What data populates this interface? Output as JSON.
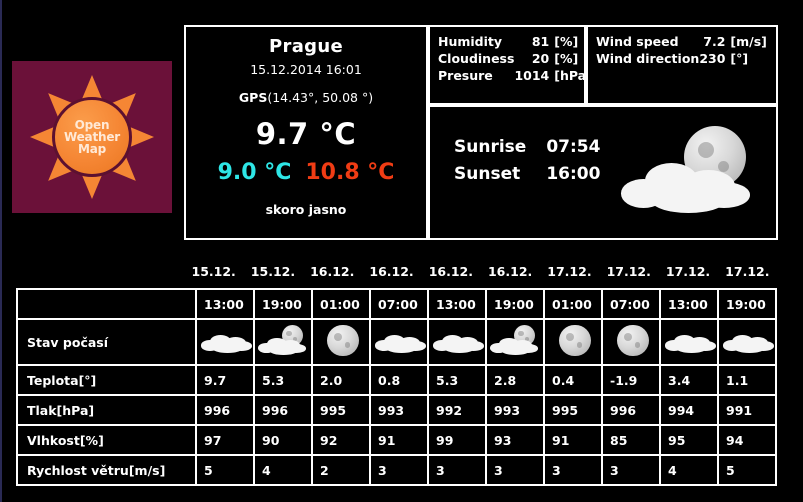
{
  "logo": {
    "name": "OpenWeatherMap",
    "line1": "Open",
    "line2": "Weather",
    "line3": "Map",
    "background_color": "#6b1139",
    "sun_color": "#f58634"
  },
  "current": {
    "city": "Prague",
    "datetime": "15.12.2014 16:01",
    "gps_label": "GPS",
    "gps_value": "(14.43°,  50.08 °)",
    "temperature": "9.7 °C",
    "temp_min": "9.0 °C",
    "temp_max": "10.8 °C",
    "temp_min_color": "#2ee6e6",
    "temp_max_color": "#f03c14",
    "description": "skoro jasno"
  },
  "metrics_left": [
    {
      "name": "Humidity",
      "value": "81",
      "unit": "[%]"
    },
    {
      "name": "Cloudiness",
      "value": "20",
      "unit": "[%]"
    },
    {
      "name": "Presure",
      "value": "1014",
      "unit": "[hPa]"
    }
  ],
  "metrics_right": [
    {
      "name": "Wind speed",
      "value": "7.2",
      "unit": "[m/s]"
    },
    {
      "name": "Wind direction",
      "value": "230",
      "unit": "[°]"
    }
  ],
  "sun": {
    "sunrise_label": "Sunrise",
    "sunrise_value": "07:54",
    "sunset_label": "Sunset",
    "sunset_value": "16:00",
    "icon": "moon-behind-cloud-icon"
  },
  "forecast": {
    "dates": [
      "15.12.",
      "15.12.",
      "16.12.",
      "16.12.",
      "16.12.",
      "16.12.",
      "17.12.",
      "17.12.",
      "17.12.",
      "17.12."
    ],
    "times": [
      "13:00",
      "19:00",
      "01:00",
      "07:00",
      "13:00",
      "19:00",
      "01:00",
      "07:00",
      "13:00",
      "19:00"
    ],
    "time_row_label": "",
    "rows": [
      {
        "label": "Stav počasí",
        "type": "icons",
        "values": [
          "cloud-icon",
          "moon-behind-cloud-icon",
          "moon-icon",
          "cloud-icon",
          "cloud-icon",
          "moon-behind-cloud-icon",
          "moon-icon",
          "moon-icon",
          "cloud-icon",
          "cloud-icon"
        ]
      },
      {
        "label": "Teplota[°]",
        "type": "text",
        "values": [
          "9.7",
          "5.3",
          "2.0",
          "0.8",
          "5.3",
          "2.8",
          "0.4",
          "-1.9",
          "3.4",
          "1.1"
        ]
      },
      {
        "label": "Tlak[hPa]",
        "type": "text",
        "values": [
          "996",
          "996",
          "995",
          "993",
          "992",
          "993",
          "995",
          "996",
          "994",
          "991"
        ]
      },
      {
        "label": "Vlhkost[%]",
        "type": "text",
        "values": [
          "97",
          "90",
          "92",
          "91",
          "99",
          "93",
          "91",
          "85",
          "95",
          "94"
        ]
      },
      {
        "label": "Rychlost větru[m/s]",
        "type": "text",
        "values": [
          "5",
          "4",
          "2",
          "3",
          "3",
          "3",
          "3",
          "3",
          "4",
          "5"
        ]
      }
    ]
  }
}
